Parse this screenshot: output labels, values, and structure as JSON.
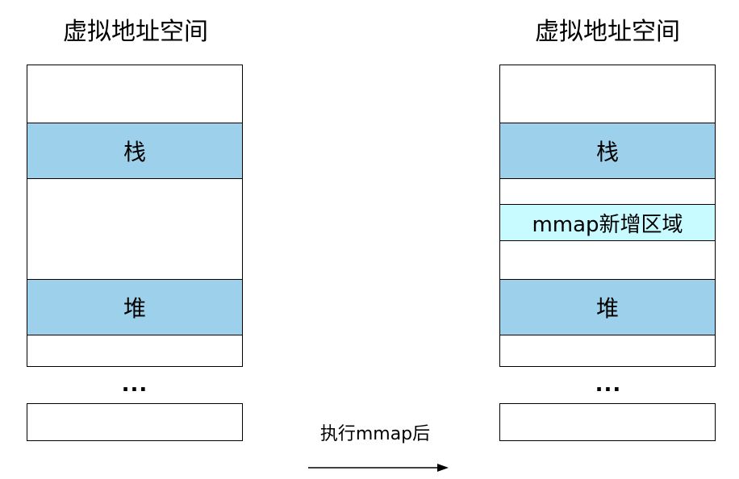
{
  "left": {
    "title": "虚拟地址空间",
    "stack_label": "栈",
    "heap_label": "堆",
    "ellipsis": "..."
  },
  "right": {
    "title": "虚拟地址空间",
    "stack_label": "栈",
    "mmap_label": "mmap新增区域",
    "heap_label": "堆",
    "ellipsis": "..."
  },
  "arrow_label": "执行mmap后",
  "colors": {
    "segment_fill": "#9dd1eb",
    "mmap_fill": "#c8fbff",
    "border": "#000000"
  }
}
